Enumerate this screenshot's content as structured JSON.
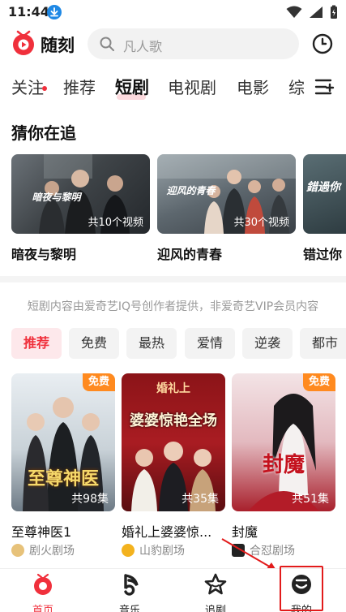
{
  "status_bar": {
    "time": "11:44"
  },
  "header": {
    "app_name": "随刻",
    "search_placeholder": "凡人歌"
  },
  "channels": {
    "items": [
      "关注",
      "推荐",
      "短剧",
      "电视剧",
      "电影",
      "综"
    ],
    "active": "短剧"
  },
  "guess_section": {
    "title": "猜你在追",
    "cards": [
      {
        "title": "暗夜与黎明",
        "badge": "共10个视频",
        "poster_text": "暗夜与黎明"
      },
      {
        "title": "迎风的青春",
        "badge": "共30个视频",
        "poster_text": "迎风的青春"
      },
      {
        "title": "错过你",
        "badge": "",
        "poster_text": "錯過你"
      }
    ]
  },
  "notice": "短剧内容由爱奇艺IQ号创作者提供，非爱奇艺VIP会员内容",
  "filters": [
    "推荐",
    "免费",
    "最热",
    "爱情",
    "逆袭",
    "都市"
  ],
  "filter_active": "推荐",
  "dramas": [
    {
      "title": "至尊神医1",
      "episodes": "共98集",
      "free": "免费",
      "studio": "剧火剧场",
      "poster_text": "至尊神医"
    },
    {
      "title": "婚礼上婆婆惊...",
      "episodes": "共35集",
      "free": "",
      "studio": "山豹剧场",
      "poster_text": "婆婆惊艳全场",
      "poster_top": "婚礼上"
    },
    {
      "title": "封魔",
      "episodes": "共51集",
      "free": "免费",
      "studio": "合怼剧场",
      "poster_text": "封魔"
    }
  ],
  "bottom_nav": [
    {
      "label": "首页",
      "icon": "home-icon"
    },
    {
      "label": "音乐",
      "icon": "music-icon"
    },
    {
      "label": "追剧",
      "icon": "star-icon"
    },
    {
      "label": "我的",
      "icon": "profile-icon"
    }
  ],
  "colors": {
    "brand_red": "#f0303c",
    "free_orange": "#ff8a1f",
    "highlight_box": "#e21b1b"
  }
}
